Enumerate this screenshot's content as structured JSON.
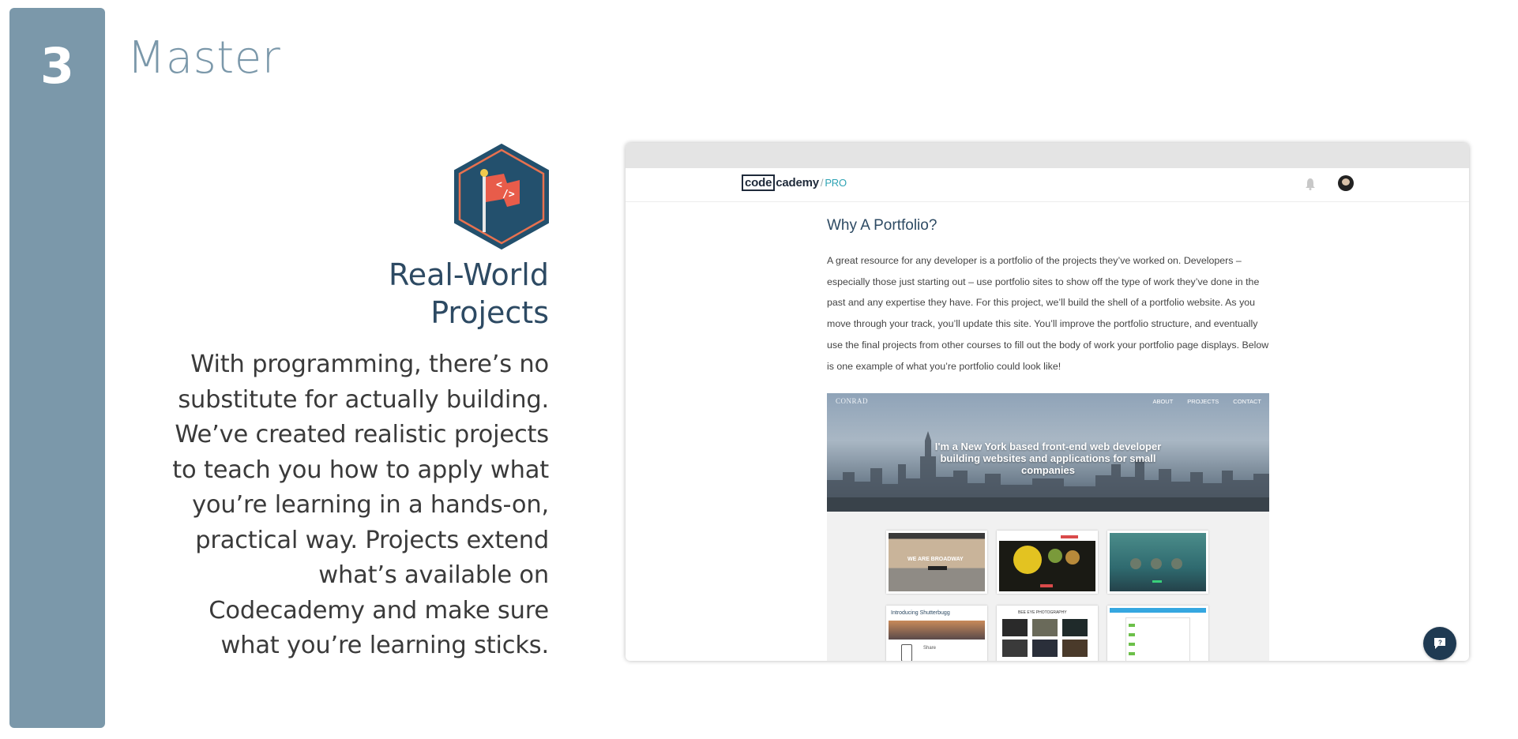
{
  "step": {
    "number": "3"
  },
  "section": {
    "title": "Master"
  },
  "feature": {
    "badge_icon": "flag-code-icon",
    "title_line1": "Real-World",
    "title_line2": "Projects",
    "description": "With programming, there’s no substitute for actually building. We’ve created realistic projects to teach you how to apply what you’re learning in a hands-on, practical way. Projects extend what’s available on Codecademy and make sure what you’re learning sticks."
  },
  "screenshot": {
    "logo_boxed": "code",
    "logo_rest": "cademy",
    "logo_suffix": "PRO",
    "article_title": "Why A Portfolio?",
    "article_body": "A great resource for any developer is a portfolio of the projects they’ve worked on. Developers – especially those just starting out – use portfolio sites to show off the type of work they’ve done in the past and any expertise they have. For this project, we’ll build the shell of a portfolio website. As you move through your track, you’ll update this site. You’ll improve the portfolio structure, and eventually use the final projects from other courses to fill out the body of work your portfolio page displays. Below is one example of what you’re portfolio could look like!",
    "preview": {
      "brand": "CONRAD",
      "nav": [
        "ABOUT",
        "PROJECTS",
        "CONTACT"
      ],
      "hero_text": "I'm a New York based front-end web developer building websites and applications for small companies",
      "thumb_broadway": "WE ARE BROADWAY",
      "thumb_shutterbugg": "Introducing Shutterbugg",
      "thumb_share": "Share",
      "thumb_photography": "BEE EYE PHOTOGRAPHY"
    }
  },
  "colors": {
    "step_bar": "#7b98aa",
    "title_navy": "#2d4a63",
    "chat_button": "#1f3a52"
  }
}
